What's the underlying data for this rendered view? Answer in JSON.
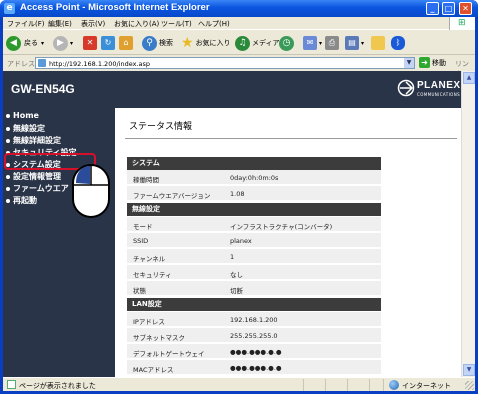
{
  "window": {
    "title": "Access Point - Microsoft Internet Explorer",
    "minimize": "_",
    "maximize": "□",
    "close": "✕"
  },
  "menubar": {
    "items": [
      "ファイル(F)",
      "編集(E)",
      "表示(V)",
      "お気に入り(A)",
      "ツール(T)",
      "ヘルプ(H)"
    ]
  },
  "toolbar": {
    "back_label": "戻る",
    "search_label": "検索",
    "favorites_label": "お気に入り",
    "media_label": "メディア"
  },
  "addressbar": {
    "label": "アドレス(D)",
    "url": "http://192.168.1.200/index.asp",
    "go_label": "移動",
    "links_label": "リンク »"
  },
  "header": {
    "product": "GW-EN54G",
    "brand": "PLANEX",
    "brand_sub": "COMMUNICATIONS"
  },
  "sidebar": {
    "items": [
      {
        "label": "Home"
      },
      {
        "label": "無線設定"
      },
      {
        "label": "無線詳細設定"
      },
      {
        "label": "セキュリティ設定"
      },
      {
        "label": "システム設定"
      },
      {
        "label": "設定情報管理"
      },
      {
        "label": "ファームウエア"
      },
      {
        "label": "再起動"
      }
    ]
  },
  "main": {
    "title": "ステータス情報",
    "sections": [
      {
        "header": "システム",
        "rows": [
          {
            "key": "稼働時間",
            "value": "0day:0h:0m:0s"
          },
          {
            "key": "ファームウエアバージョン",
            "value": "1.08"
          }
        ]
      },
      {
        "header": "無線設定",
        "rows": [
          {
            "key": "モード",
            "value": "インフラストラクチャ(コンバータ)"
          },
          {
            "key": "SSID",
            "value": "planex"
          },
          {
            "key": "チャンネル",
            "value": "1"
          },
          {
            "key": "セキュリティ",
            "value": "なし"
          },
          {
            "key": "状態",
            "value": "切断"
          }
        ]
      },
      {
        "header": "LAN設定",
        "rows": [
          {
            "key": "IPアドレス",
            "value": "192.168.1.200"
          },
          {
            "key": "サブネットマスク",
            "value": "255.255.255.0"
          },
          {
            "key": "デフォルトゲートウェイ",
            "value": "●●●.●●●.●.●"
          },
          {
            "key": "MACアドレス",
            "value": "●●●.●●●.●.●"
          }
        ]
      }
    ]
  },
  "statusbar": {
    "text": "ページが表示されました",
    "zone": "インターネット"
  },
  "colors": {
    "titlebar": "#0b55e0",
    "nav_background": "#2a3448",
    "highlight": "#d5102a",
    "section_header": "#3c3c3c",
    "row_background": "#efefef"
  }
}
